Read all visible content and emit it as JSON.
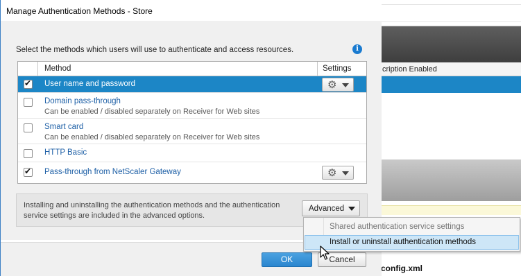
{
  "window": {
    "title": "Manage Authentication Methods - Store"
  },
  "background": {
    "column_header": "cription Enabled",
    "bottom_text": "config.xml"
  },
  "instruction": "Select the methods which users will use to authenticate and access resources.",
  "table": {
    "headers": {
      "method": "Method",
      "settings": "Settings"
    },
    "rows": [
      {
        "title": "User name and password",
        "subtitle": "",
        "checked": true,
        "selected": true,
        "has_settings": true
      },
      {
        "title": "Domain pass-through",
        "subtitle": "Can be enabled / disabled separately on Receiver for Web sites",
        "checked": false,
        "selected": false,
        "has_settings": false
      },
      {
        "title": "Smart card",
        "subtitle": "Can be enabled / disabled separately on Receiver for Web sites",
        "checked": false,
        "selected": false,
        "has_settings": false
      },
      {
        "title": "HTTP Basic",
        "subtitle": "",
        "checked": false,
        "selected": false,
        "has_settings": false
      },
      {
        "title": "Pass-through from NetScaler Gateway",
        "subtitle": "",
        "checked": true,
        "selected": false,
        "has_settings": true
      }
    ]
  },
  "advanced": {
    "text": "Installing and uninstalling the authentication methods and the authentication service settings are included in the advanced options.",
    "button_label": "Advanced",
    "menu_items": [
      {
        "label": "Shared authentication service settings",
        "enabled": false
      },
      {
        "label": "Install or uninstall authentication methods",
        "enabled": true,
        "hovered": true
      }
    ]
  },
  "buttons": {
    "ok": "OK",
    "cancel": "Cancel"
  },
  "icons": {
    "info": "info-icon",
    "gear": "gear-icon",
    "caret": "chevron-down-icon",
    "check": "check-icon",
    "cursor": "mouse-pointer-icon"
  },
  "colors": {
    "accent": "#1c86c6",
    "link": "#1d5fa6",
    "menu_hover": "#cde6f7"
  }
}
